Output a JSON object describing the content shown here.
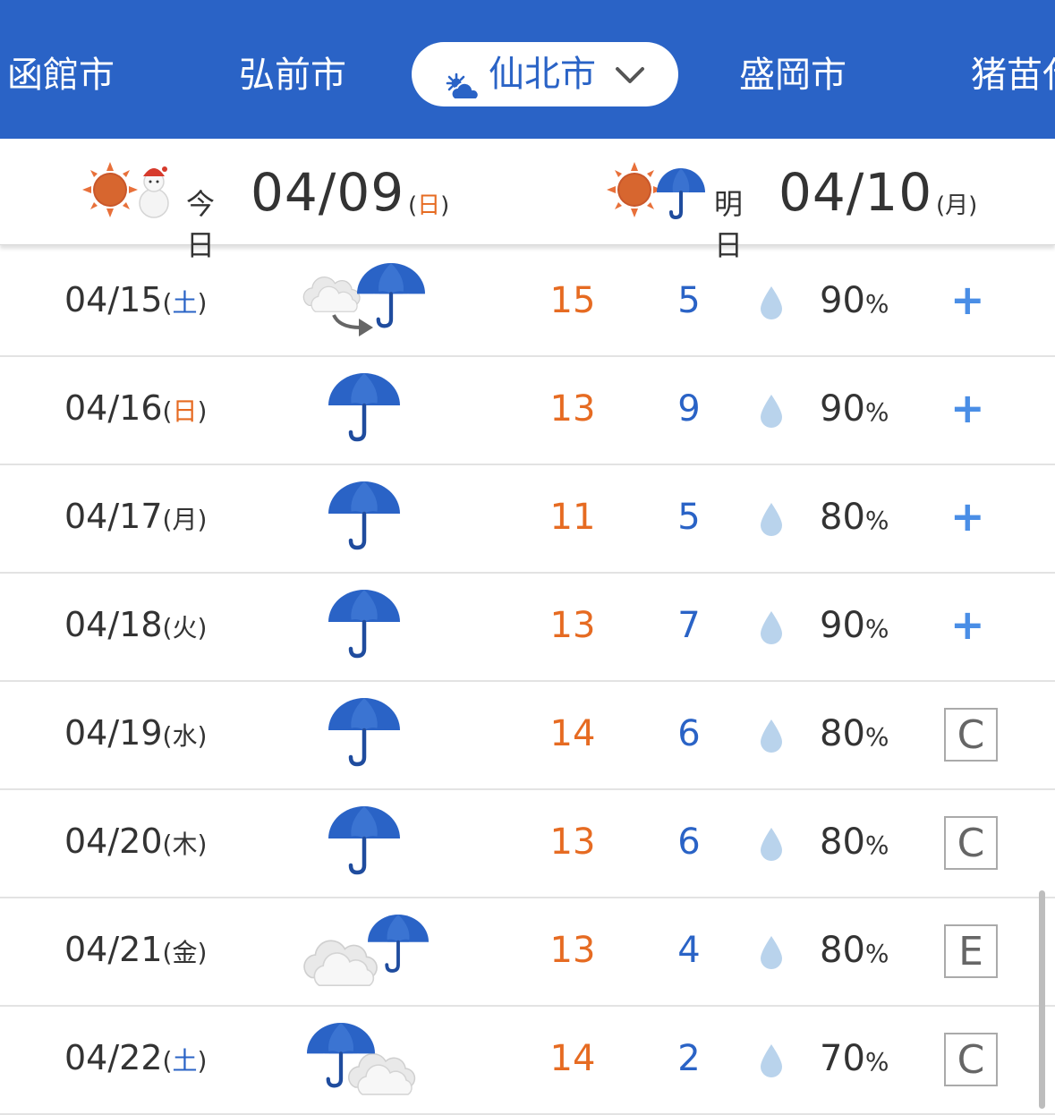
{
  "cities": {
    "items": [
      "函館市",
      "弘前市",
      "盛岡市",
      "猪苗代"
    ],
    "selected": "仙北市"
  },
  "today": {
    "label": "今日",
    "date": "04/09",
    "wd_open": "(",
    "wd": "日",
    "wd_close": ")"
  },
  "tomorrow": {
    "label": "明日",
    "date": "04/10",
    "wd_open": "(",
    "wd": "月",
    "wd_close": ")"
  },
  "colors": {
    "brand": "#2a63c6",
    "high": "#e66b22",
    "low": "#2a63c6",
    "plus": "#4a8ee6"
  },
  "days": [
    {
      "date": "04/15",
      "wd": "土",
      "icon": "cloudy-then-rain",
      "high": "15",
      "low": "5",
      "pop": "90",
      "rel": "+"
    },
    {
      "date": "04/16",
      "wd": "日",
      "icon": "rain",
      "high": "13",
      "low": "9",
      "pop": "90",
      "rel": "+"
    },
    {
      "date": "04/17",
      "wd": "月",
      "icon": "rain",
      "high": "11",
      "low": "5",
      "pop": "80",
      "rel": "+"
    },
    {
      "date": "04/18",
      "wd": "火",
      "icon": "rain",
      "high": "13",
      "low": "7",
      "pop": "90",
      "rel": "+"
    },
    {
      "date": "04/19",
      "wd": "水",
      "icon": "rain",
      "high": "14",
      "low": "6",
      "pop": "80",
      "rel": "C"
    },
    {
      "date": "04/20",
      "wd": "木",
      "icon": "rain",
      "high": "13",
      "low": "6",
      "pop": "80",
      "rel": "C"
    },
    {
      "date": "04/21",
      "wd": "金",
      "icon": "cloudy-occasional-rain",
      "high": "13",
      "low": "4",
      "pop": "80",
      "rel": "E"
    },
    {
      "date": "04/22",
      "wd": "土",
      "icon": "rain-occasional-cloudy",
      "high": "14",
      "low": "2",
      "pop": "70",
      "rel": "C"
    }
  ],
  "units": {
    "percent": "%"
  }
}
